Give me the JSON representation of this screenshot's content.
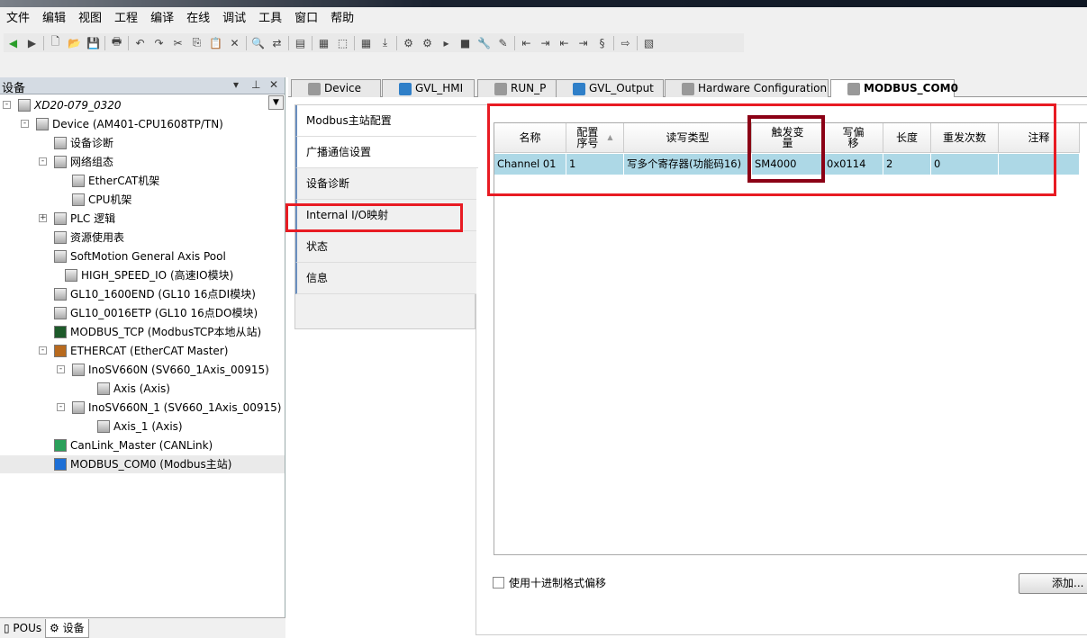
{
  "menu": [
    "文件",
    "编辑",
    "视图",
    "工程",
    "编译",
    "在线",
    "调试",
    "工具",
    "窗口",
    "帮助"
  ],
  "panel": {
    "title": "设备"
  },
  "tree": [
    {
      "label": "XD20-079_0320",
      "level": 0,
      "exp": "-",
      "italic": true,
      "icon": "project-icon"
    },
    {
      "label": "Device (AM401-CPU1608TP/TN)",
      "level": 1,
      "exp": "-",
      "icon": "device-icon"
    },
    {
      "label": "设备诊断",
      "level": 2,
      "icon": "diagnosis-icon"
    },
    {
      "label": "网络组态",
      "level": 2,
      "exp": "-",
      "icon": "network-config-icon"
    },
    {
      "label": "EtherCAT机架",
      "level": 3,
      "icon": "rack-icon"
    },
    {
      "label": "CPU机架",
      "level": 3,
      "icon": "rack-icon"
    },
    {
      "label": "PLC 逻辑",
      "level": 2,
      "exp": "+",
      "icon": "plc-logic-icon"
    },
    {
      "label": "资源使用表",
      "level": 2,
      "icon": "table-icon"
    },
    {
      "label": "SoftMotion General Axis Pool",
      "level": 2,
      "icon": "axis-pool-icon"
    },
    {
      "label": "HIGH_SPEED_IO (高速IO模块)",
      "level": 2,
      "icon": "io-module-icon",
      "extra": 12
    },
    {
      "label": "GL10_1600END (GL10 16点DI模块)",
      "level": 2,
      "icon": "device-icon"
    },
    {
      "label": "GL10_0016ETP (GL10 16点DO模块)",
      "level": 2,
      "icon": "device-icon"
    },
    {
      "label": "MODBUS_TCP (ModbusTCP本地从站)",
      "level": 2,
      "icon": "modbus-tcp-icon"
    },
    {
      "label": "ETHERCAT (EtherCAT Master)",
      "level": 2,
      "exp": "-",
      "icon": "ethercat-icon"
    },
    {
      "label": "InoSV660N (SV660_1Axis_00915)",
      "level": 3,
      "exp": "-",
      "icon": "device-icon"
    },
    {
      "label": "Axis (Axis)",
      "level": 4,
      "icon": "axis-icon"
    },
    {
      "label": "InoSV660N_1 (SV660_1Axis_00915)",
      "level": 3,
      "exp": "-",
      "icon": "device-icon"
    },
    {
      "label": "Axis_1 (Axis)",
      "level": 4,
      "icon": "axis-icon"
    },
    {
      "label": "CanLink_Master (CANLink)",
      "level": 2,
      "icon": "canlink-icon"
    },
    {
      "label": "MODBUS_COM0 (Modbus主站)",
      "level": 2,
      "icon": "modbus-com-icon",
      "selected": true
    }
  ],
  "bottom_tabs": [
    "POUs",
    "设备"
  ],
  "editor_tabs": [
    {
      "label": "Device",
      "icon": "device-icon"
    },
    {
      "label": "GVL_HMI",
      "icon": "globe-icon"
    },
    {
      "label": "RUN_P",
      "icon": "program-icon"
    },
    {
      "label": "GVL_Output",
      "icon": "globe-icon"
    },
    {
      "label": "Hardware Configuration",
      "icon": "hardware-icon"
    },
    {
      "label": "MODBUS_COM0",
      "icon": "device-icon",
      "active": true
    }
  ],
  "side_tabs": [
    "Modbus主站配置",
    "广播通信设置",
    "设备诊断",
    "Internal I/O映射",
    "状态",
    "信息"
  ],
  "table": {
    "headers": [
      "名称",
      "配置\n序号",
      "读写类型",
      "触发变\n量",
      "写偏\n移",
      "长度",
      "重发次数",
      "注释"
    ],
    "rows": [
      [
        "Channel 01",
        "1",
        "写多个寄存器(功能码16)",
        "SM4000",
        "0x0114",
        "2",
        "0",
        ""
      ]
    ]
  },
  "checkbox_label": "使用十进制格式偏移",
  "add_button": "添加...",
  "colors": {
    "highlight_red": "#e81b23",
    "dark_red": "#8b0015",
    "row_selected": "#add8e6"
  }
}
